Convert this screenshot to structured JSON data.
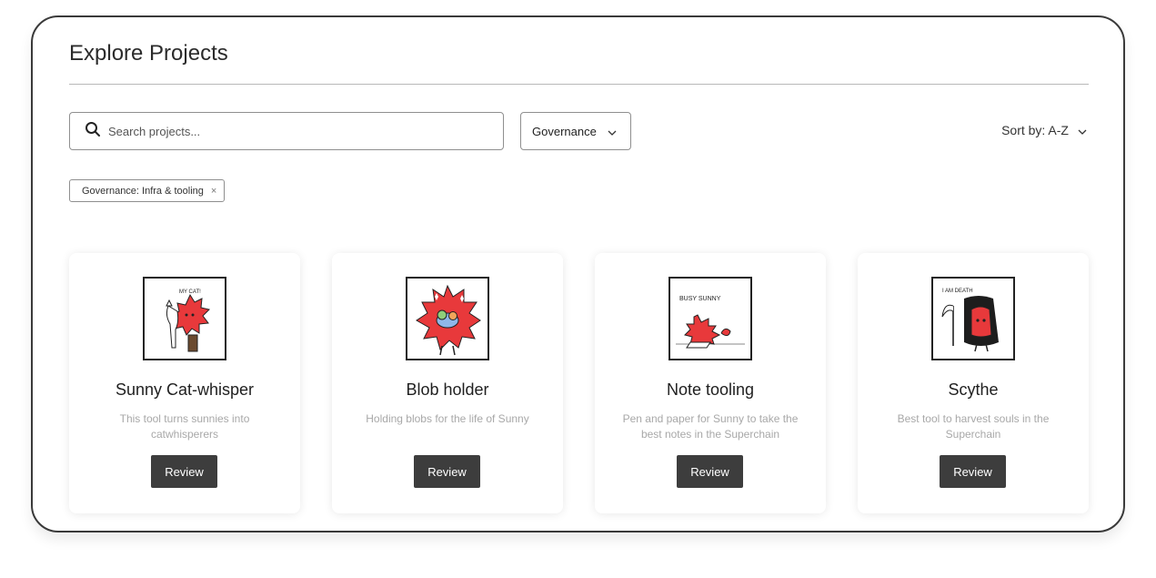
{
  "header": {
    "title": "Explore Projects"
  },
  "search": {
    "placeholder": "Search projects..."
  },
  "filter": {
    "selected": "Governance"
  },
  "sort": {
    "label": "Sort by: A-Z"
  },
  "active_filters": [
    {
      "label": "Governance: Infra & tooling",
      "close": "×"
    }
  ],
  "projects": [
    {
      "title": "Sunny Cat-whisper",
      "description": "This tool turns sunnies into catwhisperers",
      "button": "Review",
      "image_text": "MY CAT!"
    },
    {
      "title": "Blob holder",
      "description": "Holding blobs for the life of Sunny",
      "button": "Review"
    },
    {
      "title": "Note tooling",
      "description": "Pen and paper for Sunny to take the best notes in the Superchain",
      "button": "Review",
      "image_text": "BUSY SUNNY"
    },
    {
      "title": "Scythe",
      "description": "Best tool to harvest souls in the Superchain",
      "button": "Review",
      "image_text": "I AM DEATH"
    }
  ],
  "colors": {
    "accent_red": "#e8393b",
    "button": "#3d3d3d",
    "border": "#3a3a3a"
  }
}
